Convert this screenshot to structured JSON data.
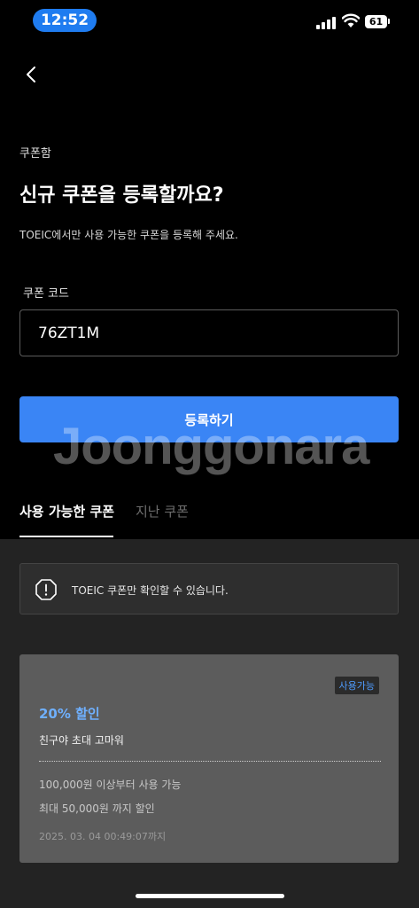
{
  "status_bar": {
    "time": "12:52",
    "battery": "61"
  },
  "header": {
    "eyebrow": "쿠폰함",
    "title": "신규 쿠폰을 등록할까요?",
    "subtitle": "TOEIC에서만 사용 가능한 쿠폰을 등록해 주세요."
  },
  "form": {
    "label": "쿠폰 코드",
    "value": "76ZT1M",
    "submit_label": "등록하기"
  },
  "watermark": "Joonggonara",
  "tabs": [
    {
      "label": "사용 가능한 쿠폰",
      "active": true
    },
    {
      "label": "지난 쿠폰",
      "active": false
    }
  ],
  "notice": {
    "text": "TOEIC 쿠폰만 확인할 수 있습니다."
  },
  "coupon": {
    "badge": "사용가능",
    "discount": "20% 할인",
    "name": "친구야 초대 고마워",
    "min_purchase": "100,000원 이상부터 사용 가능",
    "max_discount": "최대 50,000원 까지 할인",
    "expiry": "2025. 03. 04 00:49:07까지"
  },
  "colors": {
    "accent": "#3a85f5",
    "time_pill": "#1f7cf0",
    "discount": "#6fb0ff"
  },
  "icons": {
    "back": "chevron-left-icon",
    "notice": "alert-circle-icon",
    "wifi": "wifi-icon",
    "signal": "signal-icon",
    "battery": "battery-icon"
  }
}
